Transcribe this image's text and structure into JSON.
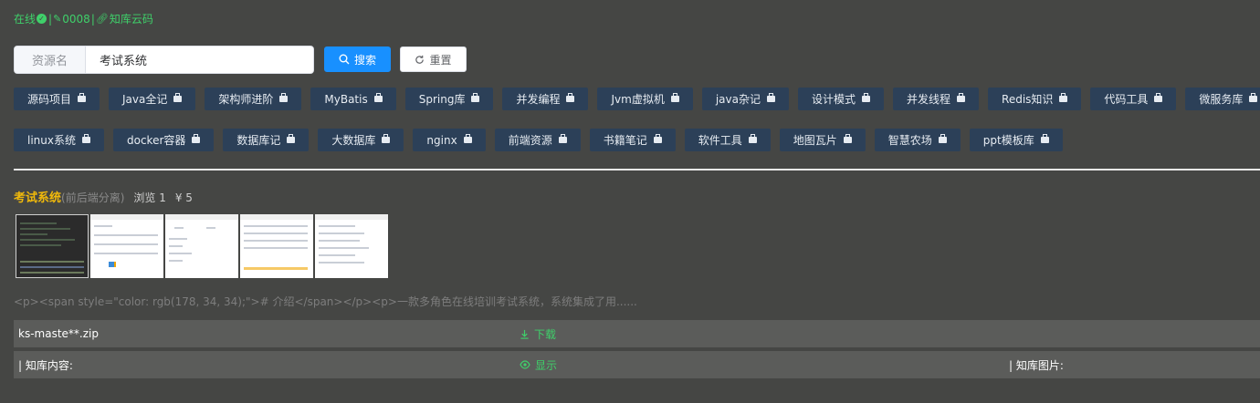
{
  "status": {
    "online": "在线",
    "separator1": "|",
    "code": "0008",
    "separator2": "|",
    "site": "知库云码"
  },
  "search": {
    "prefix": "资源名",
    "value": "考试系统",
    "search_label": "搜索",
    "reset_label": "重置"
  },
  "tags_row1": [
    "源码项目",
    "Java全记",
    "架构师进阶",
    "MyBatis",
    "Spring库",
    "并发编程",
    "Jvm虚拟机",
    "java杂记",
    "设计模式",
    "并发线程",
    "Redis知识",
    "代码工具",
    "微服务库"
  ],
  "tags_row2": [
    "linux系统",
    "docker容器",
    "数据库记",
    "大数据库",
    "nginx",
    "前端资源",
    "书籍笔记",
    "软件工具",
    "地图瓦片",
    "智慧农场",
    "ppt模板库"
  ],
  "result": {
    "name": "考试系统",
    "tag": "(前后端分离)",
    "views": "浏览 1",
    "price": "¥ 5"
  },
  "summary": "<p><span style=\"color: rgb(178, 34, 34);\"># 介绍</span></p><p>一款多角色在线培训考试系统，系统集成了用......",
  "file": {
    "name": "ks-maste**.zip",
    "download_label": "下载"
  },
  "content_row": {
    "label": "| 知库内容:",
    "show_label": "显示",
    "image_label": "| 知库图片:"
  },
  "colors": {
    "background": "#454644",
    "accent_green": "#3fd06a",
    "tag_bg": "#2c4058",
    "primary_blue": "#1890ff",
    "title_gold": "#f0b90b"
  }
}
